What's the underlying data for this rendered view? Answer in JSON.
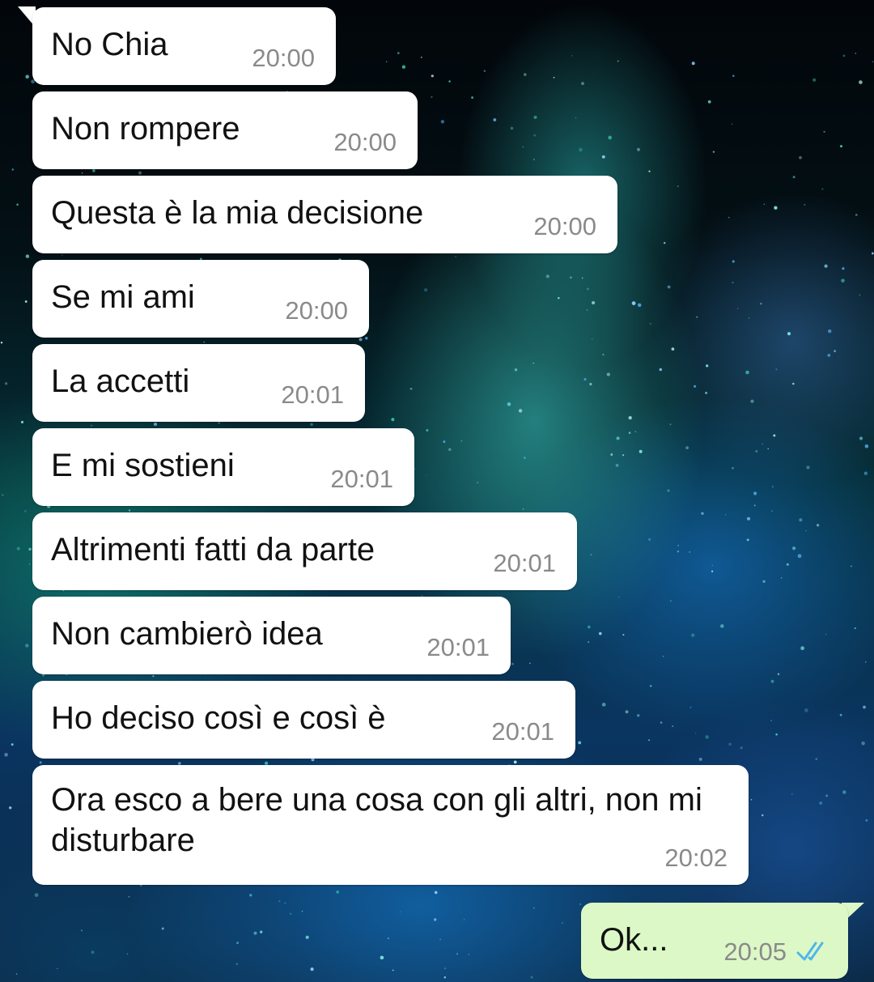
{
  "conversation": {
    "incoming": [
      {
        "text": "No Chia",
        "time": "20:00"
      },
      {
        "text": "Non rompere",
        "time": "20:00"
      },
      {
        "text": "Questa è la mia decisione",
        "time": "20:00"
      },
      {
        "text": "Se mi ami",
        "time": "20:00"
      },
      {
        "text": "La accetti",
        "time": "20:01"
      },
      {
        "text": "E mi sostieni",
        "time": "20:01"
      },
      {
        "text": "Altrimenti fatti da parte",
        "time": "20:01"
      },
      {
        "text": "Non cambierò idea",
        "time": "20:01"
      },
      {
        "text": "Ho deciso così e così è",
        "time": "20:01"
      },
      {
        "text": "Ora esco a bere una cosa con gli altri, non mi disturbare",
        "time": "20:02"
      }
    ],
    "outgoing": [
      {
        "text": "Ok...",
        "time": "20:05",
        "status_icon": "double-check-read-icon"
      }
    ]
  },
  "colors": {
    "incoming_bubble": "#ffffff",
    "outgoing_bubble": "#dcf8c6",
    "timestamp": "#8a8a8a",
    "read_ticks": "#4fb6ec"
  }
}
